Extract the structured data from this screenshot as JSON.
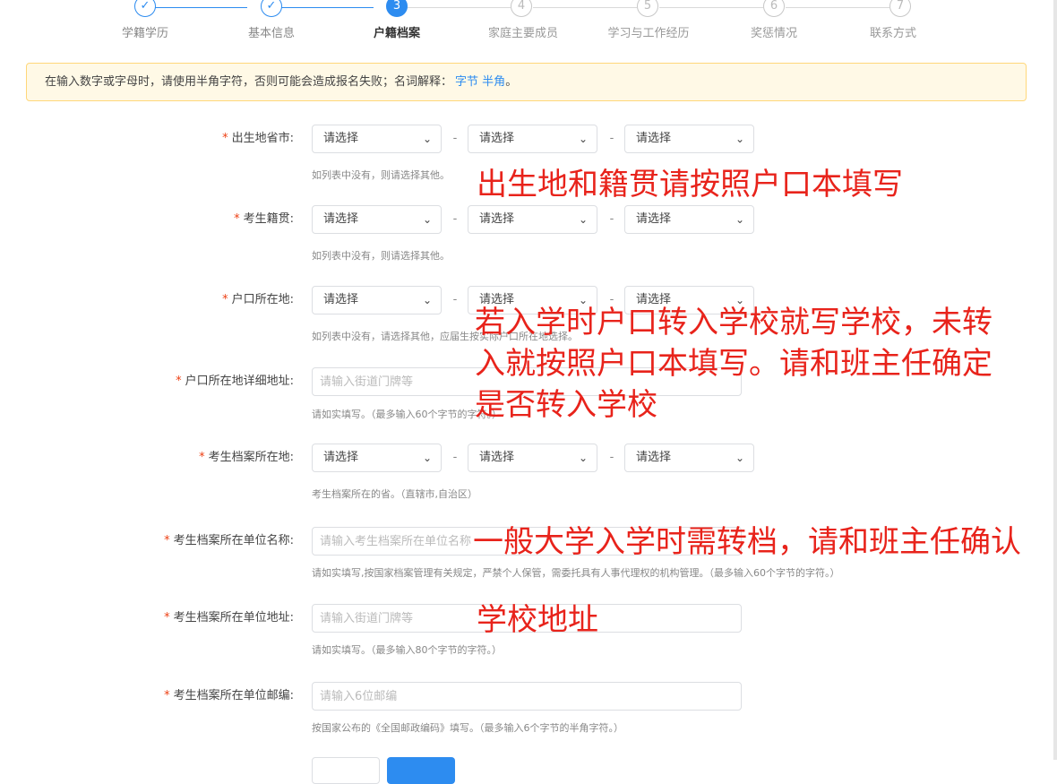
{
  "steps": [
    {
      "number": "✓",
      "label": "学籍学历",
      "state": "done"
    },
    {
      "number": "✓",
      "label": "基本信息",
      "state": "done"
    },
    {
      "number": "3",
      "label": "户籍档案",
      "state": "active"
    },
    {
      "number": "4",
      "label": "家庭主要成员",
      "state": "todo"
    },
    {
      "number": "5",
      "label": "学习与工作经历",
      "state": "todo"
    },
    {
      "number": "6",
      "label": "奖惩情况",
      "state": "todo"
    },
    {
      "number": "7",
      "label": "联系方式",
      "state": "todo"
    }
  ],
  "notice": {
    "text": "在输入数字或字母时，请使用半角字符，否则可能会造成报名失败；名词解释：",
    "link1": "字节",
    "link2": "半角",
    "end": "。"
  },
  "form": {
    "required_mark": "*",
    "select_placeholder": "请选择",
    "dash": "-",
    "birthplace": {
      "label": "出生地省市:",
      "hint": "如列表中没有，则请选择其他。"
    },
    "native_place": {
      "label": "考生籍贯:",
      "hint": "如列表中没有，则请选择其他。"
    },
    "hukou": {
      "label": "户口所在地:",
      "hint": "如列表中没有，请选择其他，应届生按实际户口所在地选择。"
    },
    "hukou_address": {
      "label": "户口所在地详细地址:",
      "placeholder": "请输入街道门牌等",
      "hint": "请如实填写。（最多输入60个字节的字符。）"
    },
    "archive_location": {
      "label": "考生档案所在地:",
      "hint": "考生档案所在的省。（直辖市,自治区）"
    },
    "archive_unit_name": {
      "label": "考生档案所在单位名称:",
      "placeholder": "请输入考生档案所在单位名称",
      "hint": "请如实填写,按国家档案管理有关规定，严禁个人保管，需委托具有人事代理权的机构管理。（最多输入60个字节的字符。）"
    },
    "archive_unit_address": {
      "label": "考生档案所在单位地址:",
      "placeholder": "请输入街道门牌等",
      "hint": "请如实填写。（最多输入80个字节的字符。）"
    },
    "archive_unit_postcode": {
      "label": "考生档案所在单位邮编:",
      "placeholder": "请输入6位邮编",
      "hint": "按国家公布的《全国邮政编码》填写。（最多输入6个字节的半角字符。）"
    }
  },
  "annotations": {
    "note1": "出生地和籍贯请按照户口本填写",
    "note2_line1": "若入学时户口转入学校就写学校，未转",
    "note2_line2": "入就按照户口本填写。请和班主任确定",
    "note2_line3": "是否转入学校",
    "note3": "一般大学入学时需转档，请和班主任确认",
    "note4": "学校地址"
  },
  "colors": {
    "accent": "#2d8cf0",
    "annotation": "#e8231b",
    "required": "#ed4014",
    "notice_bg": "#fff9e6",
    "notice_border": "#ffd77a"
  }
}
